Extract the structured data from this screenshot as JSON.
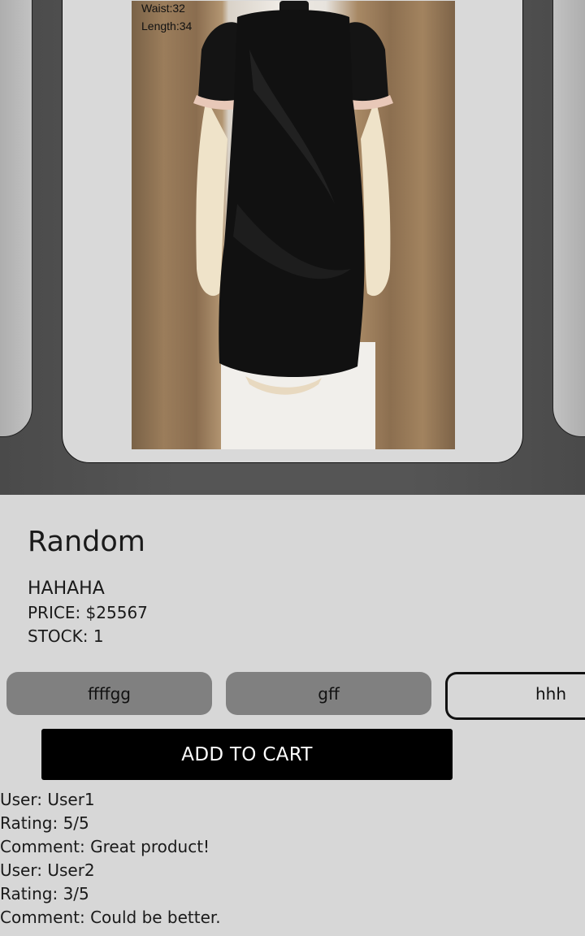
{
  "image": {
    "caption_lines": [
      "Waist:32",
      "Length:34"
    ]
  },
  "product": {
    "title": "Random",
    "description": "HAHAHA",
    "price": "PRICE: $25567",
    "stock": "STOCK: 1"
  },
  "options": [
    {
      "label": "ffffgg",
      "selected": false
    },
    {
      "label": "gff",
      "selected": false
    },
    {
      "label": "hhh",
      "selected": true
    }
  ],
  "add_to_cart_label": "ADD TO CART",
  "reviews": [
    {
      "user": "User: User1",
      "rating": "Rating: 5/5",
      "comment": "Comment: Great product!"
    },
    {
      "user": "User: User2",
      "rating": "Rating: 3/5",
      "comment": "Comment: Could be better."
    }
  ]
}
